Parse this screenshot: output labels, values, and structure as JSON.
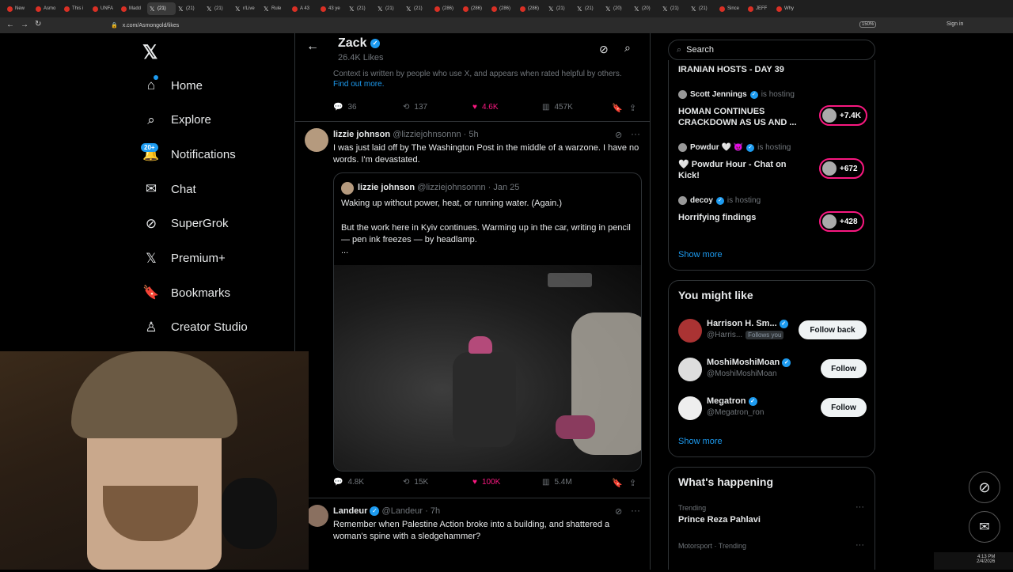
{
  "browser": {
    "tabs": [
      "New",
      "Asmo",
      "This i",
      "UNFA",
      "Madd",
      "(21)",
      "(21)",
      "(21)",
      "r/Live",
      "Rule",
      "A 43",
      "43 ye",
      "(21)",
      "(21)",
      "(21)",
      "(286)",
      "(286)",
      "(286)",
      "(286)",
      "(21)",
      "(21)",
      "(20)",
      "(20)",
      "(21)",
      "(21)",
      "Since",
      "JEFF",
      "Why"
    ],
    "url": "x.com/Asmongold/likes",
    "zoom": "150%",
    "sign_in": "Sign in"
  },
  "nav": {
    "items": [
      "Home",
      "Explore",
      "Notifications",
      "Chat",
      "SuperGrok",
      "Premium+",
      "Bookmarks",
      "Creator Studio"
    ],
    "notif_badge": "20+"
  },
  "profile_header": {
    "name": "Zack",
    "likes": "26.4K Likes"
  },
  "note": {
    "text": "Context is written by people who use X, and appears when rated helpful by others.",
    "link": "Find out more."
  },
  "post1_actions": {
    "replies": "36",
    "reposts": "137",
    "likes": "4.6K",
    "views": "457K"
  },
  "post2": {
    "name": "lizzie johnson",
    "handle": "@lizziejohnsonnn",
    "time": "· 5h",
    "text": "I was just laid off by The Washington Post in the middle of a warzone. I have no words. I'm devastated.",
    "quote": {
      "name": "lizzie johnson",
      "handle": "@lizziejohnsonnn",
      "time": "· Jan 25",
      "line1": "Waking up without power, heat, or running water. (Again.)",
      "line2": "But the work here in Kyiv continues. Warming up in the car, writing in pencil — pen ink freezes — by headlamp.",
      "line3": "..."
    },
    "actions": {
      "replies": "4.8K",
      "reposts": "15K",
      "likes": "100K",
      "views": "5.4M"
    }
  },
  "post3": {
    "name": "Landeur",
    "handle": "@Landeur",
    "time": "· 7h",
    "text": "Remember when Palestine Action broke into a building, and shattered a woman's spine with a sledgehammer?"
  },
  "search": {
    "placeholder": "Search"
  },
  "spaces": {
    "top_title": "IRANIAN HOSTS - DAY 39",
    "items": [
      {
        "host": "Scott Jennings",
        "status": "is hosting",
        "title": "HOMAN CONTINUES CRACKDOWN AS US AND ...",
        "count": "+7.4K"
      },
      {
        "host": "Powdur 🤍 😈",
        "status": "is hosting",
        "title": "🤍 Powdur Hour - Chat on Kick!",
        "count": "+672"
      },
      {
        "host": "decoy",
        "status": "is hosting",
        "title": "Horrifying findings",
        "count": "+428"
      }
    ],
    "show_more": "Show more"
  },
  "you_might_like": {
    "title": "You might like",
    "users": [
      {
        "name": "Harrison H. Sm...",
        "handle": "@Harris...",
        "follows_you": "Follows you",
        "button": "Follow back"
      },
      {
        "name": "MoshiMoshiMoan",
        "handle": "@MoshiMoshiMoan",
        "button": "Follow"
      },
      {
        "name": "Megatron",
        "handle": "@Megatron_ron",
        "button": "Follow"
      }
    ],
    "show_more": "Show more"
  },
  "happening": {
    "title": "What's happening",
    "items": [
      {
        "category": "Trending",
        "topic": "Prince Reza Pahlavi"
      },
      {
        "category": "Motorsport · Trending",
        "topic": ""
      }
    ]
  },
  "taskbar": {
    "time": "4:13 PM",
    "date": "2/4/2026"
  },
  "colors": {
    "accent": "#1d9bf0",
    "like": "#f91880",
    "bg": "#000000",
    "border": "#2f3336"
  }
}
